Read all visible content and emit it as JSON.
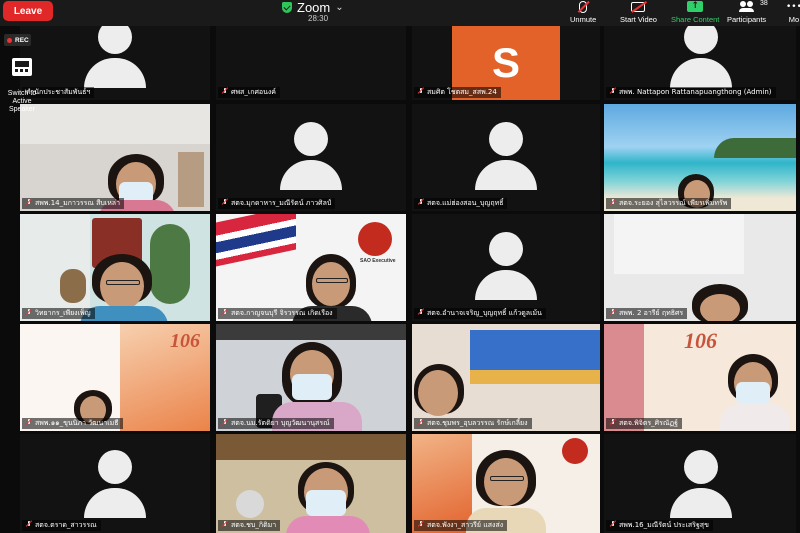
{
  "toolbar": {
    "leave_label": "Leave",
    "app_title": "Zoom",
    "timer": "28:30",
    "unmute_label": "Unmute",
    "start_video_label": "Start Video",
    "share_label": "Share Content",
    "participants_label": "Participants",
    "participants_count": "38",
    "more_label": "Mo"
  },
  "overlay": {
    "rec_label": "REC",
    "switch_line1": "Switch to",
    "switch_line2": "Active Speaker"
  },
  "colors": {
    "leave": "#e02828",
    "share": "#2fd06a",
    "accent_orange": "#e3622a"
  },
  "tiles": [
    {
      "name": "สำนักประชาสัมพันธ์ฯ",
      "kind": "avatar"
    },
    {
      "name": "ศพส_เกศอนงค์",
      "kind": "avatar"
    },
    {
      "name": "สมศิต โชตสม_สสพ.24",
      "kind": "letter",
      "letter": "S"
    },
    {
      "name": "สพพ. Nattapon Rattanapuangthong (Admin)",
      "kind": "avatar"
    },
    {
      "name": "สพพ.14_มกาวรรณ สืบเหล่า",
      "kind": "photo"
    },
    {
      "name": "สตจ.มุกดาหาร_มณีรัตน์ ภาวศิลป์",
      "kind": "avatar"
    },
    {
      "name": "สตจ.แม่ฮ่องสอน_บุญฤทธิ์",
      "kind": "avatar"
    },
    {
      "name": "สตจ.ระยอง สุไลวรรณ์ เพียรเพิ่มทรัพ",
      "kind": "photo"
    },
    {
      "name": "วิทยากร_เพียงเพ็ญ",
      "kind": "photo"
    },
    {
      "name": "สตจ.กาญจนบุรี จิรวรรณ เกิดเรือง",
      "kind": "photo",
      "sign_title": "SAO Executive"
    },
    {
      "name": "สตจ.อำนาจเจริญ_บุญฤทธิ์ แก้วดูลเม้น",
      "kind": "avatar"
    },
    {
      "name": "สพพ. 2 อารีย์ ฤทธิศร",
      "kind": "photo"
    },
    {
      "name": "สพพ.๑๑_ขุนนิภา วัฒนาเมธี",
      "kind": "photo",
      "banner": "106"
    },
    {
      "name": "สตจ.นม.รัตติยา บุญวัฒนานุสรณ์",
      "kind": "photo"
    },
    {
      "name": "สตจ.ชุมพร_อุบลวรรณ รักษ์เกลี้ยง",
      "kind": "photo"
    },
    {
      "name": "สตจ.พิจิตร_ศิรณัฏฐ์",
      "kind": "photo",
      "banner": "106"
    },
    {
      "name": "สตจ.ตราด_สาวรรณ",
      "kind": "avatar"
    },
    {
      "name": "สตจ.ชบ_กิติมา",
      "kind": "photo"
    },
    {
      "name": "สตจ.พังงา_สาวรีย์ แสงส่ง",
      "kind": "photo"
    },
    {
      "name": "สพพ.16_มณีรัตน์ ประเสริฐสุข",
      "kind": "avatar"
    }
  ]
}
